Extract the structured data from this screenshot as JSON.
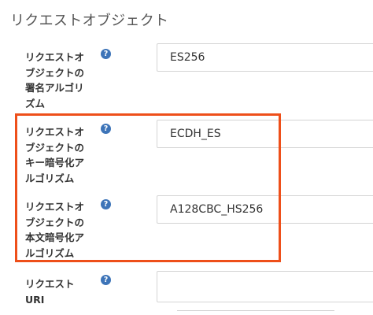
{
  "section": {
    "title": "リクエストオブジェクト"
  },
  "help_icon_glyph": "?",
  "fields": [
    {
      "label_lines": [
        "リクエストオ",
        "ブジェクトの",
        "署名アルゴリ",
        "ズム"
      ],
      "value": "ES256"
    },
    {
      "label_lines": [
        "リクエストオ",
        "ブジェクトの",
        "キー暗号化ア",
        "ルゴリズム"
      ],
      "value": "ECDH_ES"
    },
    {
      "label_lines": [
        "リクエストオ",
        "ブジェクトの",
        "本文暗号化ア",
        "ルゴリズム"
      ],
      "value": "A128CBC_HS256"
    },
    {
      "label_lines": [
        "リクエスト",
        "URI"
      ],
      "value": ""
    }
  ],
  "colors": {
    "highlight": "#ee4f1a",
    "help_icon": "#3d74b8"
  }
}
